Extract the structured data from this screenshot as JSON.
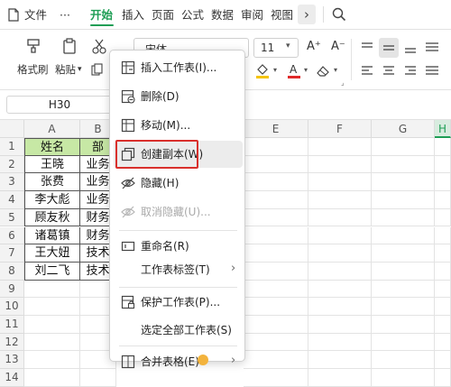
{
  "menubar": {
    "file": "文件",
    "more": "···",
    "tabs": [
      "开始",
      "插入",
      "页面",
      "公式",
      "数据",
      "审阅",
      "视图"
    ],
    "more_tabs": "›"
  },
  "ribbon": {
    "format_painter": "格式刷",
    "paste": "粘贴",
    "paste_arrow": "▾",
    "font_name": "宋体",
    "font_size": "11",
    "grow_font": "A⁺",
    "shrink_font": "A⁻"
  },
  "namebox": {
    "value": "H30"
  },
  "columns": [
    "A",
    "B",
    "E",
    "F",
    "G",
    "H"
  ],
  "rows": [
    "1",
    "2",
    "3",
    "4",
    "5",
    "6",
    "7",
    "8",
    "9",
    "10",
    "11",
    "12",
    "13",
    "14"
  ],
  "table": {
    "header": [
      "姓名",
      "部"
    ],
    "rows": [
      [
        "王晓",
        "业务"
      ],
      [
        "张费",
        "业务"
      ],
      [
        "李大彪",
        "业务"
      ],
      [
        "顾友秋",
        "财务"
      ],
      [
        "诸葛镇",
        "财务"
      ],
      [
        "王大妞",
        "技术"
      ],
      [
        "刘二飞",
        "技术"
      ]
    ]
  },
  "context_menu": {
    "items": [
      {
        "label": "插入工作表(I)...",
        "icon": "insert-sheet-icon",
        "enabled": true
      },
      {
        "label": "删除(D)",
        "icon": "delete-sheet-icon",
        "enabled": true
      },
      {
        "label": "移动(M)...",
        "icon": "move-sheet-icon",
        "enabled": true
      },
      {
        "label": "创建副本(W)",
        "icon": "copy-sheet-icon",
        "enabled": true
      },
      {
        "label": "隐藏(H)",
        "icon": "hide-eye-icon",
        "enabled": true
      },
      {
        "label": "取消隐藏(U)...",
        "icon": "unhide-eye-icon",
        "enabled": false
      },
      {
        "label": "重命名(R)",
        "icon": "rename-icon",
        "enabled": true
      },
      {
        "label": "工作表标签(T)",
        "icon": "",
        "enabled": true,
        "submenu": true
      },
      {
        "label": "保护工作表(P)...",
        "icon": "protect-sheet-icon",
        "enabled": true
      },
      {
        "label": "选定全部工作表(S)",
        "icon": "",
        "enabled": true
      },
      {
        "label": "合并表格(E)",
        "icon": "merge-table-icon",
        "enabled": true,
        "submenu": true
      }
    ],
    "highlighted": "创建副本(W)"
  },
  "colors": {
    "accent": "#1e9e55",
    "header_fill": "#c7e8a5",
    "highlight_border": "#d9302c"
  }
}
